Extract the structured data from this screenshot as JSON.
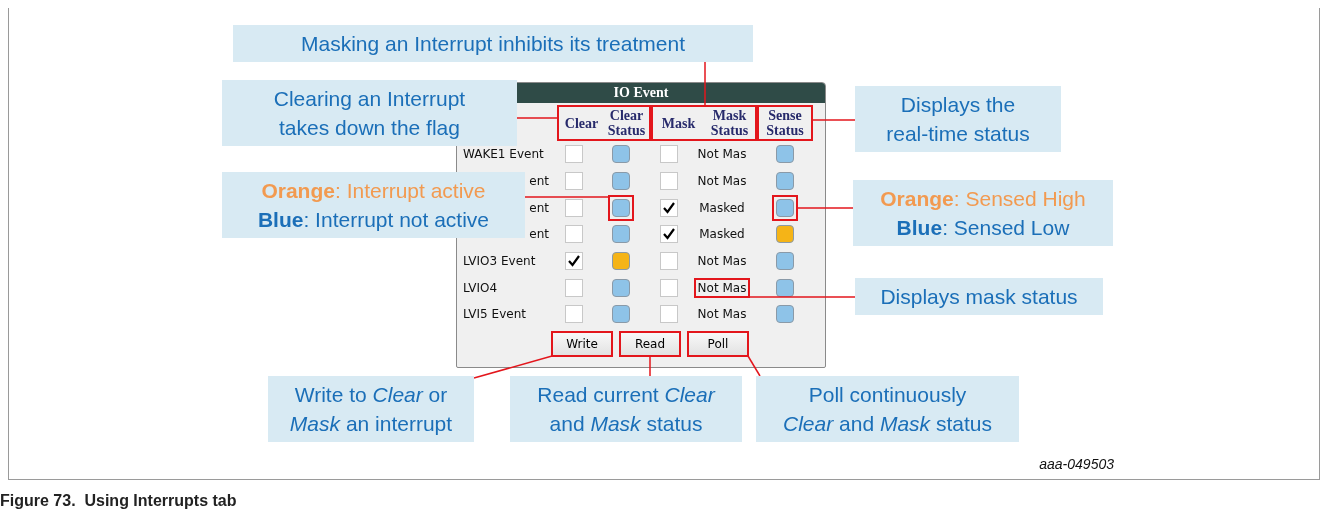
{
  "window": {
    "title": "IO Event",
    "header_groups": [
      {
        "labels": [
          "Clear",
          "Clear Status"
        ],
        "highlighted": true
      },
      {
        "labels": [
          "Mask",
          "Mask Status"
        ],
        "highlighted": true
      },
      {
        "labels": [
          "Sense Status"
        ],
        "highlighted": true
      }
    ],
    "rows": [
      {
        "label": "WAKE1 Event",
        "clipped": false,
        "clear": false,
        "clear_status": {
          "color": "#8ec3e8",
          "highlighted": false
        },
        "mask": false,
        "mask_status": {
          "text": "Not Mas",
          "highlighted": false
        },
        "sense": {
          "color": "#8ec3e8",
          "highlighted": false
        }
      },
      {
        "label": "ent",
        "clipped": true,
        "clear": false,
        "clear_status": {
          "color": "#8ec3e8",
          "highlighted": false
        },
        "mask": false,
        "mask_status": {
          "text": "Not Mas",
          "highlighted": false
        },
        "sense": {
          "color": "#8ec3e8",
          "highlighted": false
        }
      },
      {
        "label": "ent",
        "clipped": true,
        "clear": false,
        "clear_status": {
          "color": "#8ec3e8",
          "highlighted": true
        },
        "mask": true,
        "mask_status": {
          "text": "Masked",
          "highlighted": false
        },
        "sense": {
          "color": "#8ec3e8",
          "highlighted": true
        }
      },
      {
        "label": "ent",
        "clipped": true,
        "clear": false,
        "clear_status": {
          "color": "#8ec3e8",
          "highlighted": false
        },
        "mask": true,
        "mask_status": {
          "text": "Masked",
          "highlighted": false
        },
        "sense": {
          "color": "#f5b417",
          "highlighted": false
        }
      },
      {
        "label": "LVIO3 Event",
        "clipped": false,
        "clear": true,
        "clear_status": {
          "color": "#f5b417",
          "highlighted": false
        },
        "mask": false,
        "mask_status": {
          "text": "Not Mas",
          "highlighted": false
        },
        "sense": {
          "color": "#8ec3e8",
          "highlighted": false
        }
      },
      {
        "label": "LVIO4",
        "clipped": false,
        "clear": false,
        "clear_status": {
          "color": "#8ec3e8",
          "highlighted": false
        },
        "mask": false,
        "mask_status": {
          "text": "Not Mas",
          "highlighted": true
        },
        "sense": {
          "color": "#8ec3e8",
          "highlighted": false
        }
      },
      {
        "label": "LVI5 Event",
        "clipped": false,
        "clear": false,
        "clear_status": {
          "color": "#8ec3e8",
          "highlighted": false
        },
        "mask": false,
        "mask_status": {
          "text": "Not Mas",
          "highlighted": false
        },
        "sense": {
          "color": "#8ec3e8",
          "highlighted": false
        }
      }
    ],
    "buttons": [
      {
        "label": "Write",
        "highlighted": true
      },
      {
        "label": "Read",
        "highlighted": true
      },
      {
        "label": "Poll",
        "highlighted": true
      }
    ]
  },
  "callouts": [
    {
      "lines": [
        {
          "text": "Masking an Interrupt inhibits its treatment"
        }
      ]
    },
    {
      "lines": [
        {
          "text": "Clearing an Interrupt"
        },
        {
          "text": "takes down the flag"
        }
      ]
    },
    {
      "lines": [
        {
          "text": "**Orange**: Interrupt active",
          "color": "#f29a50"
        },
        {
          "text": "**Blue**: Interrupt not active",
          "color": "#1b6fb8"
        }
      ]
    },
    {
      "lines": [
        {
          "text": "Displays the"
        },
        {
          "text": "real-time status"
        }
      ]
    },
    {
      "lines": [
        {
          "text": "**Orange**: Sensed High",
          "color": "#f29a50"
        },
        {
          "text": "**Blue**: Sensed Low",
          "color": "#1b6fb8"
        }
      ]
    },
    {
      "lines": [
        {
          "text": "Displays mask status"
        }
      ]
    },
    {
      "lines": [
        {
          "text": "Write to *Clear* or"
        },
        {
          "text": "*Mask* an interrupt"
        }
      ]
    },
    {
      "lines": [
        {
          "text": "Read current *Clear*"
        },
        {
          "text": "and *Mask* status"
        }
      ]
    },
    {
      "lines": [
        {
          "text": "Poll continuously"
        },
        {
          "text": "*Clear* and *Mask* status"
        }
      ]
    }
  ],
  "figure_code": "aaa-049503",
  "caption": "Figure 73.  Using Interrupts tab"
}
